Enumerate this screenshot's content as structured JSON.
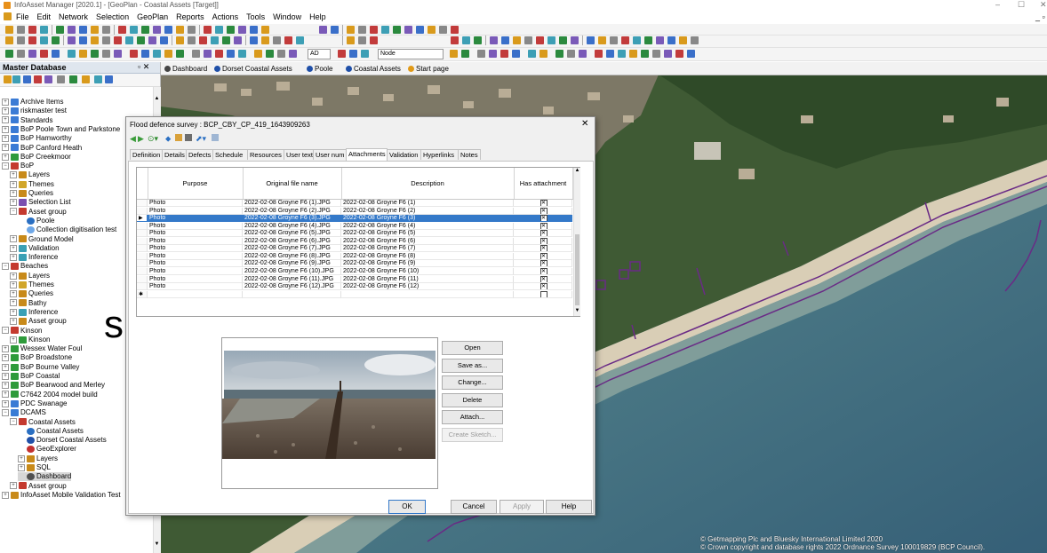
{
  "window": {
    "title": "InfoAsset Manager [2020.1] - [GeoPlan - Coastal Assets [Target]]",
    "controls": [
      "–",
      "☐",
      "✕"
    ]
  },
  "menu": [
    "File",
    "Edit",
    "Network",
    "Selection",
    "GeoPlan",
    "Reports",
    "Actions",
    "Tools",
    "Window",
    "Help"
  ],
  "toolbar": {
    "combo1": "AD",
    "combo2": "Node"
  },
  "left_panel": {
    "title": "Master Database",
    "tree": [
      {
        "label": "Archive Items",
        "level": 0,
        "exp": "+",
        "icon": "folder"
      },
      {
        "label": "riskmaster test",
        "level": 0,
        "exp": "+",
        "icon": "folder"
      },
      {
        "label": "Standards",
        "level": 0,
        "exp": "+",
        "icon": "folder"
      },
      {
        "label": "BoP Poole Town and Parkstone",
        "level": 0,
        "exp": "+",
        "icon": "folder"
      },
      {
        "label": "BoP Hamworthy",
        "level": 0,
        "exp": "+",
        "icon": "folder"
      },
      {
        "label": "BoP Canford Heath",
        "level": 0,
        "exp": "+",
        "icon": "folder"
      },
      {
        "label": "BoP Creekmoor",
        "level": 0,
        "exp": "+",
        "icon": "model"
      },
      {
        "label": "BoP",
        "level": 0,
        "exp": "−",
        "icon": "asset"
      },
      {
        "label": "Layers",
        "level": 1,
        "exp": "+",
        "icon": "layers"
      },
      {
        "label": "Themes",
        "level": 1,
        "exp": "+",
        "icon": "themes"
      },
      {
        "label": "Queries",
        "level": 1,
        "exp": "+",
        "icon": "layers"
      },
      {
        "label": "Selection List",
        "level": 1,
        "exp": "+",
        "icon": "sel"
      },
      {
        "label": "Asset group",
        "level": 1,
        "exp": "−",
        "icon": "asset"
      },
      {
        "label": "Poole",
        "level": 2,
        "exp": "",
        "icon": "poole"
      },
      {
        "label": "Collection digitisation test",
        "level": 2,
        "exp": "",
        "icon": "globe"
      },
      {
        "label": "Ground Model",
        "level": 1,
        "exp": "+",
        "icon": "layers"
      },
      {
        "label": "Validation",
        "level": 1,
        "exp": "+",
        "icon": "valid"
      },
      {
        "label": "Inference",
        "level": 1,
        "exp": "+",
        "icon": "valid"
      },
      {
        "label": "Beaches",
        "level": 0,
        "exp": "−",
        "icon": "asset"
      },
      {
        "label": "Layers",
        "level": 1,
        "exp": "+",
        "icon": "layers"
      },
      {
        "label": "Themes",
        "level": 1,
        "exp": "+",
        "icon": "themes"
      },
      {
        "label": "Queries",
        "level": 1,
        "exp": "+",
        "icon": "layers"
      },
      {
        "label": "Bathy",
        "level": 1,
        "exp": "+",
        "icon": "layers"
      },
      {
        "label": "Inference",
        "level": 1,
        "exp": "+",
        "icon": "valid"
      },
      {
        "label": "Asset group",
        "level": 1,
        "exp": "+",
        "icon": "layers"
      },
      {
        "label": "Kinson",
        "level": 0,
        "exp": "−",
        "icon": "asset"
      },
      {
        "label": "Kinson",
        "level": 1,
        "exp": "+",
        "icon": "model"
      },
      {
        "label": "Wessex Water Foul",
        "level": 0,
        "exp": "+",
        "icon": "model"
      },
      {
        "label": "BoP Broadstone",
        "level": 0,
        "exp": "+",
        "icon": "model"
      },
      {
        "label": "BoP Bourne Valley",
        "level": 0,
        "exp": "+",
        "icon": "model"
      },
      {
        "label": "BoP Coastal",
        "level": 0,
        "exp": "+",
        "icon": "model"
      },
      {
        "label": "BoP Bearwood and Merley",
        "level": 0,
        "exp": "+",
        "icon": "model"
      },
      {
        "label": "C7642 2004 model build",
        "level": 0,
        "exp": "+",
        "icon": "model"
      },
      {
        "label": "PDC Swanage",
        "level": 0,
        "exp": "+",
        "icon": "folder"
      },
      {
        "label": "DCAMS",
        "level": 0,
        "exp": "−",
        "icon": "folder"
      },
      {
        "label": "Coastal Assets",
        "level": 1,
        "exp": "−",
        "icon": "asset"
      },
      {
        "label": "Coastal Assets",
        "level": 2,
        "exp": "",
        "icon": "poole"
      },
      {
        "label": "Dorset Coastal Assets",
        "level": 2,
        "exp": "",
        "icon": "dorset"
      },
      {
        "label": "GeoExplorer",
        "level": 2,
        "exp": "",
        "icon": "geo"
      },
      {
        "label": "Layers",
        "level": 2,
        "exp": "+",
        "icon": "layers"
      },
      {
        "label": "SQL",
        "level": 2,
        "exp": "+",
        "icon": "layers"
      },
      {
        "label": "Dashboard",
        "level": 2,
        "exp": "",
        "icon": "dash",
        "selected": true
      },
      {
        "label": "Asset group",
        "level": 1,
        "exp": "+",
        "icon": "asset"
      },
      {
        "label": "InfoAsset Mobile Validation Test",
        "level": 0,
        "exp": "+",
        "icon": "layers"
      }
    ]
  },
  "map_tabs": [
    "Dashboard",
    "Dorset Coastal Assets",
    "Poole",
    "Coastal Assets",
    "Start page"
  ],
  "map_copyright": [
    "© Getmapping Plc and Bluesky International Limited 2020",
    "© Crown copyright and database rights 2022 Ordnance Survey 100019829 (BCP Council)."
  ],
  "stray_letter": "s",
  "dialog": {
    "title": "Flood defence survey : BCP_CBY_CP_419_1643909263",
    "tabs": [
      "Definition",
      "Details",
      "Defects",
      "Schedule",
      "Resources",
      "User text",
      "User num",
      "Attachments",
      "Validation",
      "Hyperlinks",
      "Notes"
    ],
    "active_tab": "Attachments",
    "grid": {
      "columns": [
        "Purpose",
        "Original file name",
        "Description",
        "Has attachment"
      ],
      "rows": [
        {
          "purpose": "Photo",
          "file": "2022-02-08 Groyne F6 (1).JPG",
          "desc": "2022-02-08 Groyne F6 (1)",
          "has": true
        },
        {
          "purpose": "Photo",
          "file": "2022-02-08 Groyne F6 (2).JPG",
          "desc": "2022-02-08 Groyne F6 (2)",
          "has": true
        },
        {
          "purpose": "Photo",
          "file": "2022-02-08 Groyne F6 (3).JPG",
          "desc": "2022-02-08 Groyne F6 (3)",
          "has": true,
          "selected": true
        },
        {
          "purpose": "Photo",
          "file": "2022-02-08 Groyne F6 (4).JPG",
          "desc": "2022-02-08 Groyne F6 (4)",
          "has": true
        },
        {
          "purpose": "Photo",
          "file": "2022-02-08 Groyne F6 (5).JPG",
          "desc": "2022-02-08 Groyne F6 (5)",
          "has": true
        },
        {
          "purpose": "Photo",
          "file": "2022-02-08 Groyne F6 (6).JPG",
          "desc": "2022-02-08 Groyne F6 (6)",
          "has": true
        },
        {
          "purpose": "Photo",
          "file": "2022-02-08 Groyne F6 (7).JPG",
          "desc": "2022-02-08 Groyne F6 (7)",
          "has": true
        },
        {
          "purpose": "Photo",
          "file": "2022-02-08 Groyne F6 (8).JPG",
          "desc": "2022-02-08 Groyne F6 (8)",
          "has": true
        },
        {
          "purpose": "Photo",
          "file": "2022-02-08 Groyne F6 (9).JPG",
          "desc": "2022-02-08 Groyne F6 (9)",
          "has": true
        },
        {
          "purpose": "Photo",
          "file": "2022-02-08 Groyne F6 (10).JPG",
          "desc": "2022-02-08 Groyne F6 (10)",
          "has": true
        },
        {
          "purpose": "Photo",
          "file": "2022-02-08 Groyne F6 (11).JPG",
          "desc": "2022-02-08 Groyne F6 (11)",
          "has": true
        },
        {
          "purpose": "Photo",
          "file": "2022-02-08 Groyne F6 (12).JPG",
          "desc": "2022-02-08 Groyne F6 (12)",
          "has": true
        },
        {
          "purpose": "",
          "file": "",
          "desc": "",
          "has": false,
          "new_row": true
        }
      ]
    },
    "side_buttons": [
      "Open",
      "Save as...",
      "Change...",
      "Delete",
      "Attach...",
      "Create Sketch..."
    ],
    "bottom_buttons": [
      "OK",
      "Cancel",
      "Apply",
      "Help"
    ]
  },
  "colors": {
    "selection": "#3479c9",
    "map_track": "#6a2b86",
    "header_bg": "#dfe6ee"
  }
}
